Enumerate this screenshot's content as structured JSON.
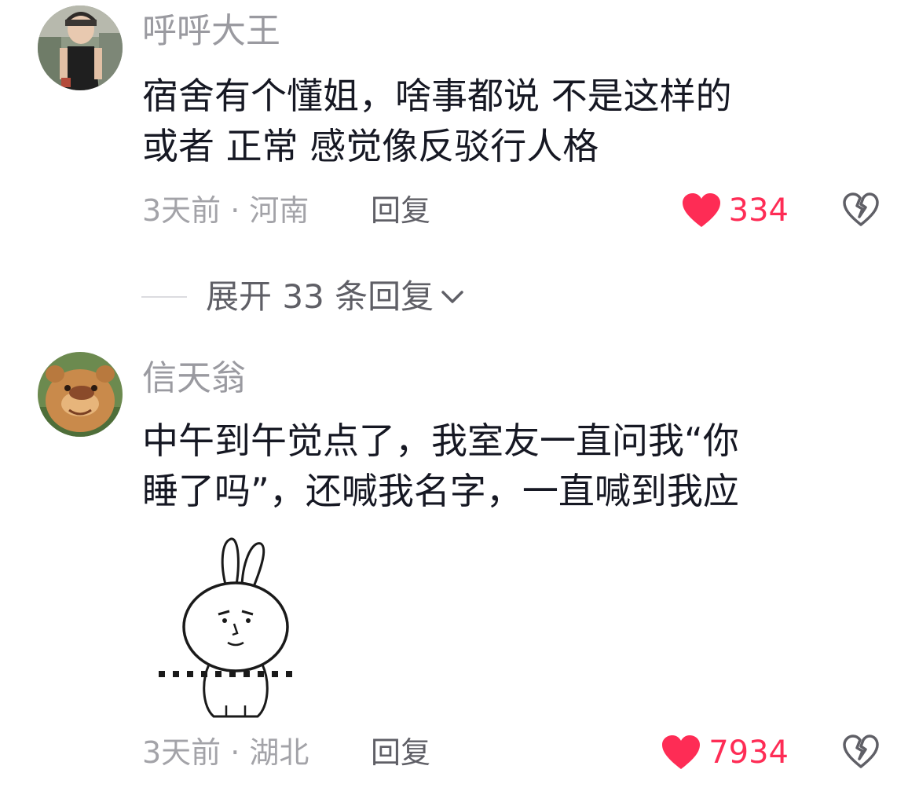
{
  "comments": [
    {
      "username": "呼呼大王",
      "text_lines": [
        "宿舍有个懂姐，啥事都说 不是这样的",
        "或者 正常  感觉像反驳行人格"
      ],
      "time_location": "3天前 · 河南",
      "reply_label": "回复",
      "likes": "334"
    },
    {
      "username": "信天翁",
      "text_lines": [
        "中午到午觉点了，我室友一直问我“你",
        "睡了吗”，还喊我名字，一直喊到我应"
      ],
      "time_location": "3天前 · 湖北",
      "reply_label": "回复",
      "likes": "7934"
    }
  ],
  "expand": {
    "label": "展开 33 条回复"
  },
  "colors": {
    "accent": "#fe2c55",
    "muted": "#a3a3a8",
    "text": "#161823"
  },
  "icons": {
    "like": "heart-icon",
    "dislike": "broken-heart-icon",
    "expand": "chevron-down-icon"
  }
}
